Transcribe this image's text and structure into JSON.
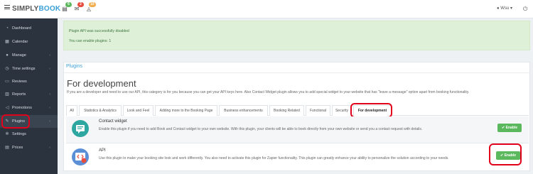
{
  "header": {
    "brand_simply": "SIMPLY",
    "brand_book": "BOOK",
    "badges": {
      "calendar": "6",
      "mail": "2",
      "bell": "10"
    },
    "user": "Wsu",
    "colors": {
      "calendar": "#5cb85c",
      "mail": "#e74c3c",
      "bell": "#f0ad4e"
    }
  },
  "sidebar": {
    "items": [
      {
        "label": "Dashboard",
        "icon": "dashboard-icon",
        "glyph": "◔"
      },
      {
        "label": "Calendar",
        "icon": "calendar-icon",
        "glyph": "▦"
      },
      {
        "label": "Manage",
        "icon": "user-icon",
        "glyph": "●"
      },
      {
        "label": "Time settings",
        "icon": "clock-icon",
        "glyph": "◷"
      },
      {
        "label": "Reviews",
        "icon": "comment-icon",
        "glyph": "▭"
      },
      {
        "label": "Reports",
        "icon": "bar-chart-icon",
        "glyph": "▥"
      },
      {
        "label": "Promotions",
        "icon": "megaphone-icon",
        "glyph": "◁"
      },
      {
        "label": "Plugins",
        "icon": "plug-icon",
        "glyph": "✎"
      },
      {
        "label": "Settings",
        "icon": "gear-icon",
        "glyph": "✲"
      },
      {
        "label": "Prices",
        "icon": "money-icon",
        "glyph": "▤"
      }
    ]
  },
  "alert": {
    "line1": "Plugin API was successfully disabled",
    "line2": "You can enable plugins: 1"
  },
  "main": {
    "section_tab": "Plugins",
    "title": "For development",
    "description": "If you are a developer and need to use our API, this category is for you because you can get your API keys here. Also Contact Widget plugin allows you to add special widget to your website that has \"leave a message\" option apart from booking functionality.",
    "tabs": [
      "All",
      "Statistics & Analytics",
      "Look and Feel",
      "Adding more to the Booking Page",
      "Business enhancements",
      "Booking Related",
      "Functional",
      "Security",
      "For development"
    ],
    "plugins": [
      {
        "title": "Contact widget",
        "description": "Enable this plugin if you need to add Book and Contact widget to your own website. With this plugin, your clients will be able to book directly from your own website or send you a contact request with details.",
        "button": "✔ Enable"
      },
      {
        "title": "API",
        "description": "Use this plugin to make your booking site look and work differently. You also need to activate this plugin for Zapier functionality. This plugin can greatly enhance your ability to personalize the solution according to your needs.",
        "button": "✔ Enable"
      }
    ]
  }
}
